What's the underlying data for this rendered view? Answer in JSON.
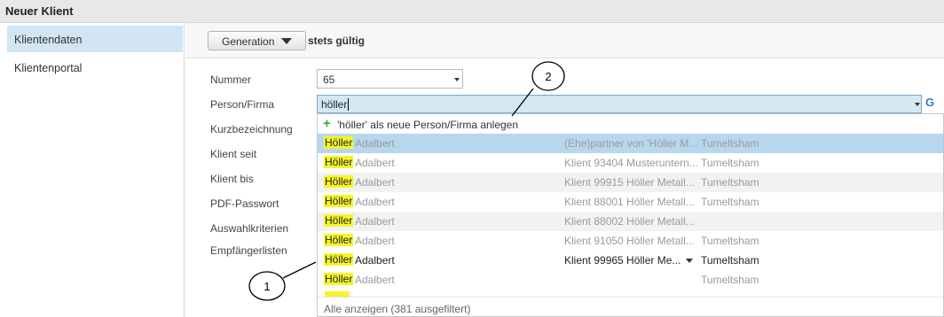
{
  "window": {
    "title": "Neuer Klient"
  },
  "sidebar": {
    "items": [
      {
        "label": "Klientendaten",
        "active": true
      },
      {
        "label": "Klientenportal",
        "active": false
      }
    ]
  },
  "toolbar": {
    "generation_label": "Generation",
    "validity": "stets gültig"
  },
  "form": {
    "labels": [
      "Nummer",
      "Person/Firma",
      "Kurzbezeichnung",
      "Klient seit",
      "Klient bis",
      "PDF-Passwort",
      "Auswahlkriterien",
      "Empfängerlisten"
    ],
    "nummer": "65",
    "person_value": "höller",
    "side_icon": "G"
  },
  "dropdown": {
    "new_entry": "'höller' als neue Person/Firma anlegen",
    "rows": [
      {
        "highlight": "Höller",
        "first": "Adalbert",
        "relation": "(Ehe)partner von 'Höller M...",
        "ort": "Tumeltsham"
      },
      {
        "highlight": "Höller",
        "first": "Adalbert",
        "relation": "Klient 93404 Musteruntern...",
        "ort": "Tumeltsham"
      },
      {
        "highlight": "Höller",
        "first": "Adalbert",
        "relation": "Klient 99915 Höller Metall...",
        "ort": "Tumeltsham"
      },
      {
        "highlight": "Höller",
        "first": "Adalbert",
        "relation": "Klient 88001 Höller Metall...",
        "ort": "Tumeltsham"
      },
      {
        "highlight": "Höller",
        "first": "Adalbert",
        "relation": "Klient 88002 Höller Metall...",
        "ort": ""
      },
      {
        "highlight": "Höller",
        "first": "Adalbert",
        "relation": "Klient 91050 Höller Metall...",
        "ort": "Tumeltsham"
      },
      {
        "highlight": "Höller",
        "first": "Adalbert",
        "relation": "Klient 99965 Höller Me...",
        "ort": "Tumeltsham"
      },
      {
        "highlight": "Höller",
        "first": "Adalbert",
        "relation": "",
        "ort": "Tumeltsham"
      }
    ],
    "footer": "Alle anzeigen (381 ausgefiltert)"
  },
  "callouts": {
    "one": "1",
    "two": "2"
  },
  "colors": {
    "selection": "#b7d7ee",
    "highlight": "#f5f52a",
    "sidebar_active": "#d2e5f2",
    "plus": "#46a33a"
  }
}
